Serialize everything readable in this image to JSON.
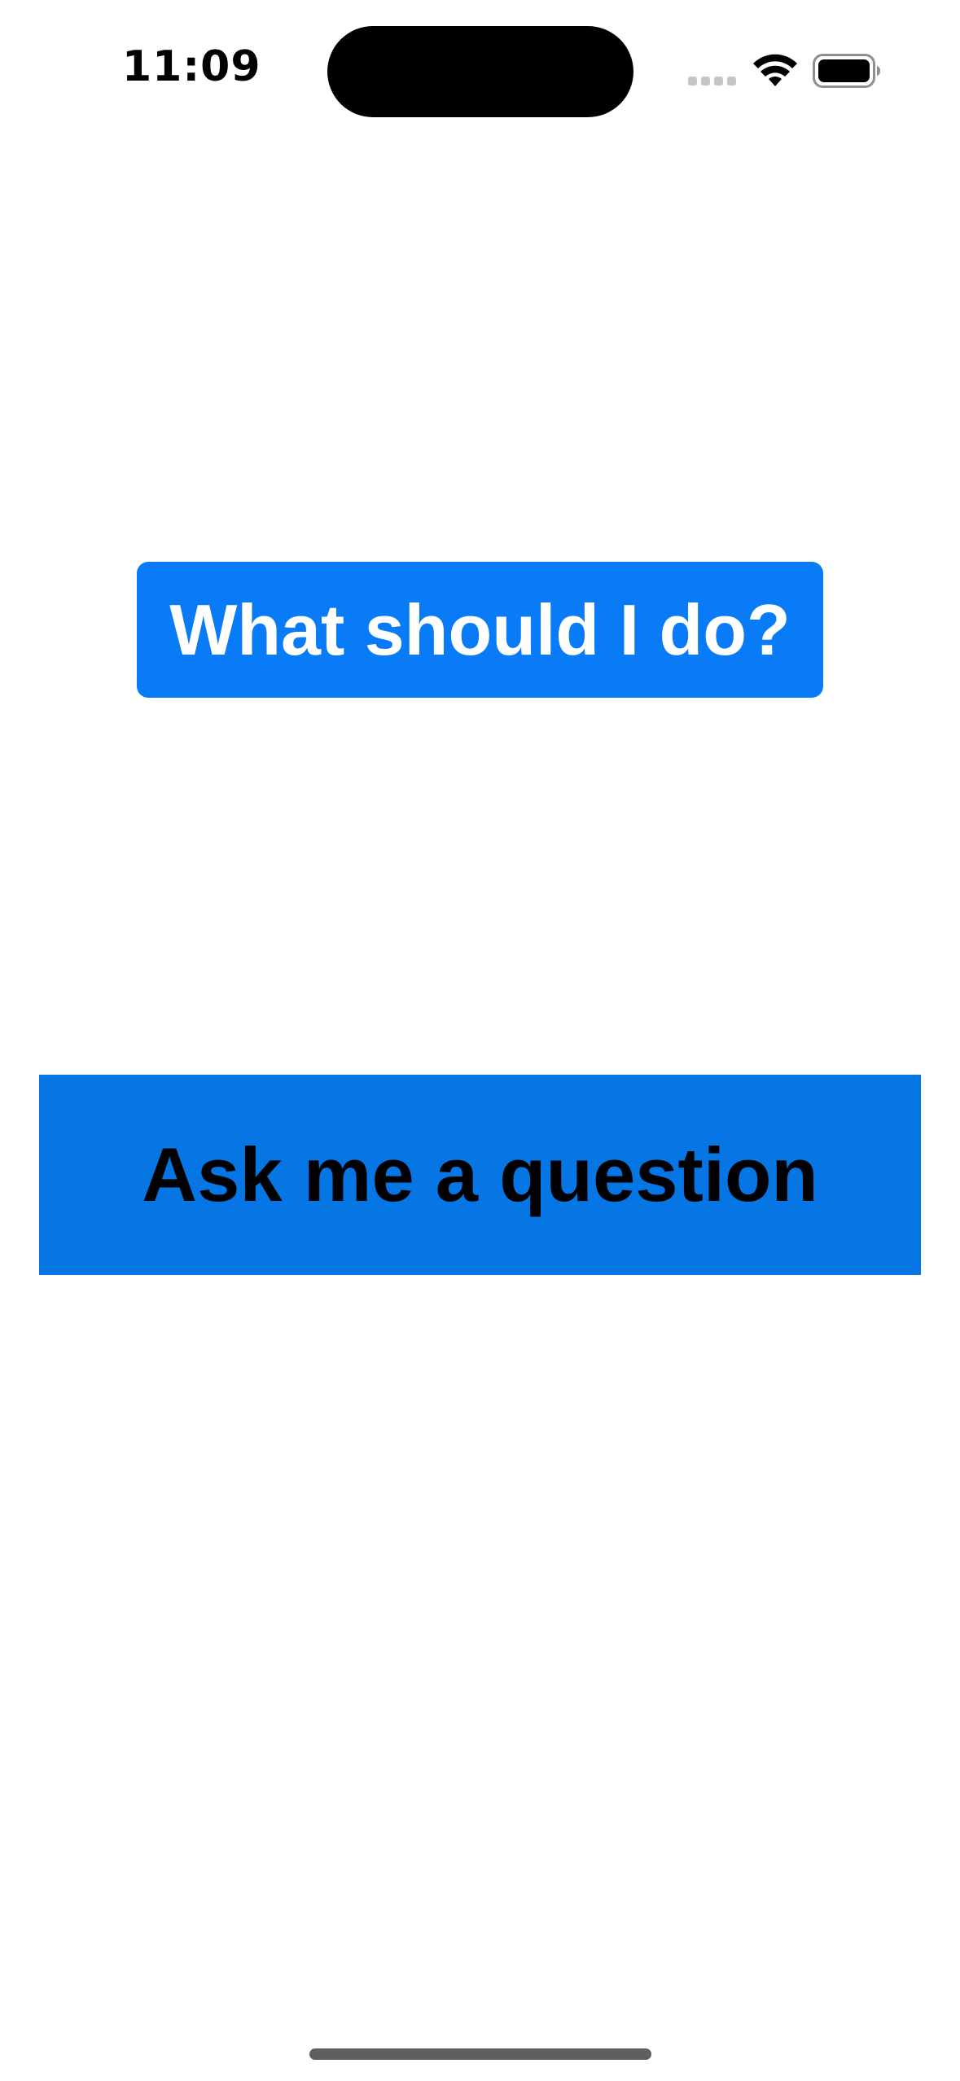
{
  "status_bar": {
    "time": "11:09",
    "icons": [
      "cellular-signal-icon",
      "wifi-icon",
      "battery-icon"
    ]
  },
  "main": {
    "title_label": "What should I do?",
    "ask_button_label": "Ask me a question"
  },
  "colors": {
    "title_background": "#0a7bf7",
    "title_text": "#ffffff",
    "ask_button_background": "#0676e4",
    "ask_button_text": "#000000",
    "page_background": "#ffffff"
  }
}
